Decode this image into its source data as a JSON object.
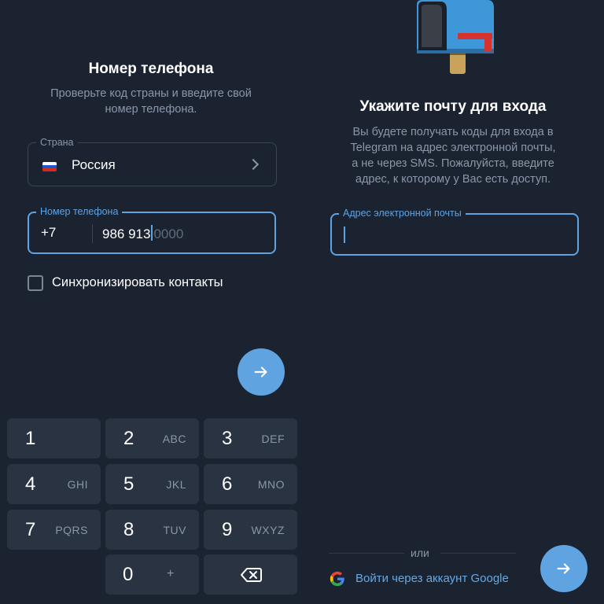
{
  "phone_screen": {
    "title": "Номер телефона",
    "subtitle_line1": "Проверьте код страны и введите свой",
    "subtitle_line2": "номер телефона.",
    "country_label": "Страна",
    "country_value": "Россия",
    "country_flag_icon": "russia-flag-icon",
    "phone_label": "Номер телефона",
    "country_code": "+7",
    "phone_entered": "986 913",
    "phone_placeholder": "0000",
    "sync_label": "Синхронизировать контакты",
    "sync_checked": false,
    "next_icon": "arrow-right-icon"
  },
  "keypad": {
    "keys": [
      {
        "num": "1",
        "letters": ""
      },
      {
        "num": "2",
        "letters": "ABC"
      },
      {
        "num": "3",
        "letters": "DEF"
      },
      {
        "num": "4",
        "letters": "GHI"
      },
      {
        "num": "5",
        "letters": "JKL"
      },
      {
        "num": "6",
        "letters": "MNO"
      },
      {
        "num": "7",
        "letters": "PQRS"
      },
      {
        "num": "8",
        "letters": "TUV"
      },
      {
        "num": "9",
        "letters": "WXYZ"
      },
      {
        "num": "0",
        "letters": "+"
      }
    ],
    "backspace_icon": "backspace-icon"
  },
  "email_screen": {
    "illustration_icon": "mailbox-icon",
    "title": "Укажите почту для входа",
    "subtitle_line1": "Вы будете получать коды для входа в",
    "subtitle_line2": "Telegram на адрес электронной почты,",
    "subtitle_line3": "а не через SMS. Пожалуйста, введите",
    "subtitle_line4": "адрес, к которому у Вас есть доступ.",
    "email_label": "Адрес электронной почты",
    "email_value": "",
    "or_text": "или",
    "google_label": "Войти через аккаунт Google",
    "google_icon": "google-icon",
    "next_icon": "arrow-right-icon"
  },
  "colors": {
    "background": "#1b2331",
    "accent": "#5fa3e1",
    "key_background": "#2a3341",
    "secondary_text": "#8a97a8"
  }
}
